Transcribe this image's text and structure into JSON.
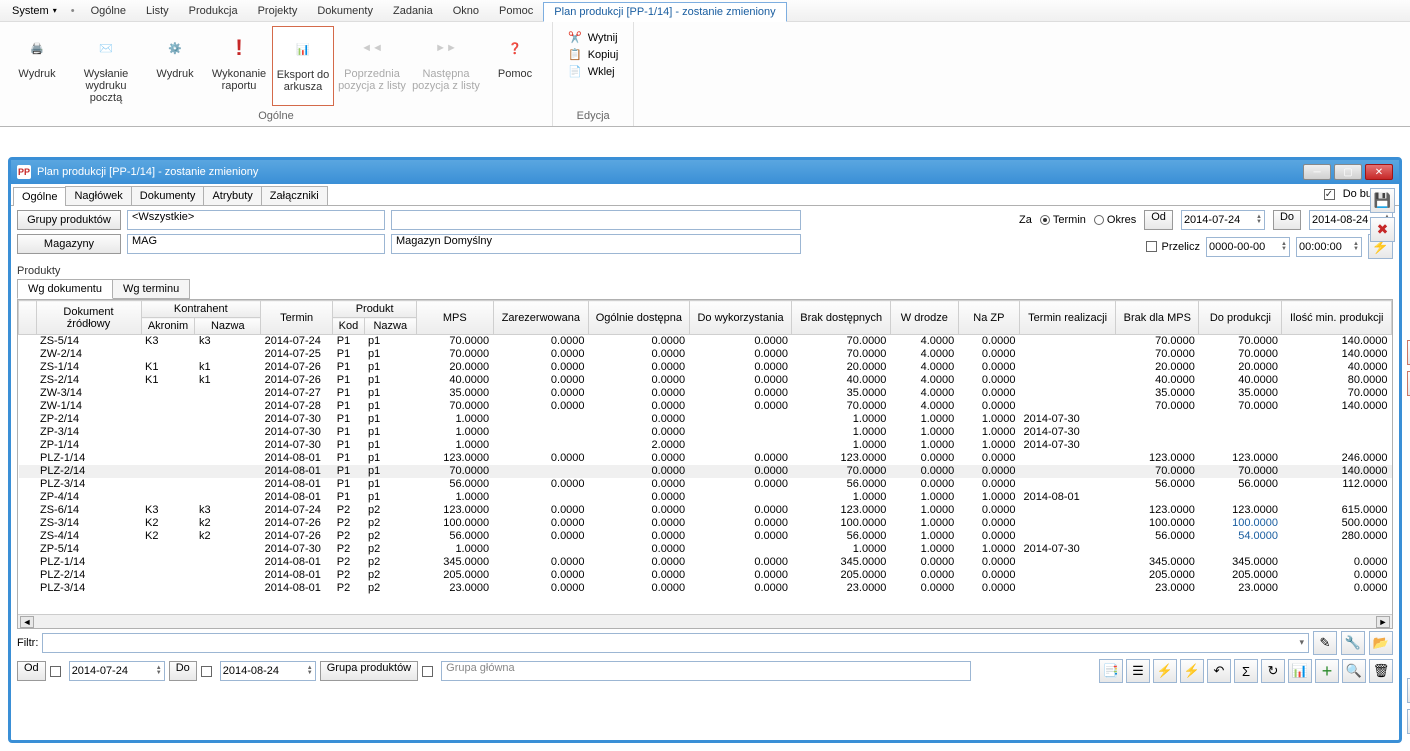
{
  "menubar": {
    "system": "System",
    "items": [
      "Ogólne",
      "Listy",
      "Produkcja",
      "Projekty",
      "Dokumenty",
      "Zadania",
      "Okno",
      "Pomoc"
    ],
    "active_tab": "Plan produkcji [PP-1/14] - zostanie zmieniony"
  },
  "ribbon": {
    "wydruk": "Wydruk",
    "wyslanie": "Wysłanie wydruku pocztą",
    "wydruk2": "Wydruk",
    "wykonanie": "Wykonanie raportu",
    "eksport": "Eksport do arkusza",
    "poprzednia": "Poprzednia pozycja z listy",
    "nastepna": "Następna pozycja z listy",
    "pomoc": "Pomoc",
    "group_ogolne": "Ogólne",
    "wytnij": "Wytnij",
    "kopiuj": "Kopiuj",
    "wklej": "Wklej",
    "group_edycja": "Edycja"
  },
  "window": {
    "title": "Plan produkcji [PP-1/14] - zostanie zmieniony",
    "tabs": [
      "Ogólne",
      "Nagłówek",
      "Dokumenty",
      "Atrybuty",
      "Załączniki"
    ],
    "do_bufora": "Do bufora",
    "grupy_btn": "Grupy produktów",
    "grupy_val": "<Wszystkie>",
    "magazyny_btn": "Magazyny",
    "magazyny_val": "MAG",
    "magazyn_name": "Magazyn Domyślny",
    "za_label": "Za",
    "termin": "Termin",
    "okres": "Okres",
    "od": "Od",
    "do": "Do",
    "date_od": "2014-07-24",
    "date_do": "2014-08-24",
    "przelicz": "Przelicz",
    "przelicz_date": "0000-00-00",
    "przelicz_time": "00:00:00",
    "produkty": "Produkty",
    "subtabs": [
      "Wg dokumentu",
      "Wg terminu"
    ],
    "headers": {
      "dok": "Dokument źródłowy",
      "kontrahent": "Kontrahent",
      "akronim": "Akronim",
      "nazwa": "Nazwa",
      "termin": "Termin",
      "produkt": "Produkt",
      "kod": "Kod",
      "nazwa2": "Nazwa",
      "mps": "MPS",
      "zarez": "Zarezerwowana",
      "ogolnie": "Ogólnie dostępna",
      "dowyk": "Do wykorzystania",
      "brak": "Brak dostępnych",
      "wdrodze": "W drodze",
      "nazp": "Na ZP",
      "terminr": "Termin realizacji",
      "brakmps": "Brak dla MPS",
      "doprod": "Do produkcji",
      "iloscmin": "Ilość min. produkcji"
    },
    "rows": [
      {
        "dok": "ZS-5/14",
        "akr": "K3",
        "naz": "k3",
        "term": "2014-07-24",
        "kod": "P1",
        "pn": "p1",
        "mps": "70.0000",
        "zar": "0.0000",
        "og": "0.0000",
        "dw": "0.0000",
        "bd": "70.0000",
        "wd": "4.0000",
        "nz": "0.0000",
        "tr": "",
        "bm": "70.0000",
        "dp": "70.0000",
        "im": "140.0000"
      },
      {
        "dok": "ZW-2/14",
        "akr": "",
        "naz": "",
        "term": "2014-07-25",
        "kod": "P1",
        "pn": "p1",
        "mps": "70.0000",
        "zar": "0.0000",
        "og": "0.0000",
        "dw": "0.0000",
        "bd": "70.0000",
        "wd": "4.0000",
        "nz": "0.0000",
        "tr": "",
        "bm": "70.0000",
        "dp": "70.0000",
        "im": "140.0000"
      },
      {
        "dok": "ZS-1/14",
        "akr": "K1",
        "naz": "k1",
        "term": "2014-07-26",
        "kod": "P1",
        "pn": "p1",
        "mps": "20.0000",
        "zar": "0.0000",
        "og": "0.0000",
        "dw": "0.0000",
        "bd": "20.0000",
        "wd": "4.0000",
        "nz": "0.0000",
        "tr": "",
        "bm": "20.0000",
        "dp": "20.0000",
        "im": "40.0000"
      },
      {
        "dok": "ZS-2/14",
        "akr": "K1",
        "naz": "k1",
        "term": "2014-07-26",
        "kod": "P1",
        "pn": "p1",
        "mps": "40.0000",
        "zar": "0.0000",
        "og": "0.0000",
        "dw": "0.0000",
        "bd": "40.0000",
        "wd": "4.0000",
        "nz": "0.0000",
        "tr": "",
        "bm": "40.0000",
        "dp": "40.0000",
        "im": "80.0000"
      },
      {
        "dok": "ZW-3/14",
        "akr": "",
        "naz": "",
        "term": "2014-07-27",
        "kod": "P1",
        "pn": "p1",
        "mps": "35.0000",
        "zar": "0.0000",
        "og": "0.0000",
        "dw": "0.0000",
        "bd": "35.0000",
        "wd": "4.0000",
        "nz": "0.0000",
        "tr": "",
        "bm": "35.0000",
        "dp": "35.0000",
        "im": "70.0000"
      },
      {
        "dok": "ZW-1/14",
        "akr": "",
        "naz": "",
        "term": "2014-07-28",
        "kod": "P1",
        "pn": "p1",
        "mps": "70.0000",
        "zar": "0.0000",
        "og": "0.0000",
        "dw": "0.0000",
        "bd": "70.0000",
        "wd": "4.0000",
        "nz": "0.0000",
        "tr": "",
        "bm": "70.0000",
        "dp": "70.0000",
        "im": "140.0000"
      },
      {
        "dok": "ZP-2/14",
        "akr": "",
        "naz": "",
        "term": "2014-07-30",
        "kod": "P1",
        "pn": "p1",
        "mps": "1.0000",
        "zar": "",
        "og": "0.0000",
        "dw": "",
        "bd": "1.0000",
        "wd": "1.0000",
        "nz": "1.0000",
        "tr": "2014-07-30",
        "bm": "",
        "dp": "",
        "im": ""
      },
      {
        "dok": "ZP-3/14",
        "akr": "",
        "naz": "",
        "term": "2014-07-30",
        "kod": "P1",
        "pn": "p1",
        "mps": "1.0000",
        "zar": "",
        "og": "0.0000",
        "dw": "",
        "bd": "1.0000",
        "wd": "1.0000",
        "nz": "1.0000",
        "tr": "2014-07-30",
        "bm": "",
        "dp": "",
        "im": ""
      },
      {
        "dok": "ZP-1/14",
        "akr": "",
        "naz": "",
        "term": "2014-07-30",
        "kod": "P1",
        "pn": "p1",
        "mps": "1.0000",
        "zar": "",
        "og": "2.0000",
        "dw": "",
        "bd": "1.0000",
        "wd": "1.0000",
        "nz": "1.0000",
        "tr": "2014-07-30",
        "bm": "",
        "dp": "",
        "im": ""
      },
      {
        "dok": "PLZ-1/14",
        "akr": "",
        "naz": "",
        "term": "2014-08-01",
        "kod": "P1",
        "pn": "p1",
        "mps": "123.0000",
        "zar": "0.0000",
        "og": "0.0000",
        "dw": "0.0000",
        "bd": "123.0000",
        "wd": "0.0000",
        "nz": "0.0000",
        "tr": "",
        "bm": "123.0000",
        "dp": "123.0000",
        "im": "246.0000"
      },
      {
        "dok": "PLZ-2/14",
        "akr": "",
        "naz": "",
        "term": "2014-08-01",
        "kod": "P1",
        "pn": "p1",
        "mps": "70.0000",
        "zar": "",
        "og": "0.0000",
        "dw": "0.0000",
        "bd": "70.0000",
        "wd": "0.0000",
        "nz": "0.0000",
        "tr": "",
        "bm": "70.0000",
        "dp": "70.0000",
        "im": "140.0000",
        "hl": true
      },
      {
        "dok": "PLZ-3/14",
        "akr": "",
        "naz": "",
        "term": "2014-08-01",
        "kod": "P1",
        "pn": "p1",
        "mps": "56.0000",
        "zar": "0.0000",
        "og": "0.0000",
        "dw": "0.0000",
        "bd": "56.0000",
        "wd": "0.0000",
        "nz": "0.0000",
        "tr": "",
        "bm": "56.0000",
        "dp": "56.0000",
        "im": "112.0000"
      },
      {
        "dok": "ZP-4/14",
        "akr": "",
        "naz": "",
        "term": "2014-08-01",
        "kod": "P1",
        "pn": "p1",
        "mps": "1.0000",
        "zar": "",
        "og": "0.0000",
        "dw": "",
        "bd": "1.0000",
        "wd": "1.0000",
        "nz": "1.0000",
        "tr": "2014-08-01",
        "bm": "",
        "dp": "",
        "im": ""
      },
      {
        "dok": "ZS-6/14",
        "akr": "K3",
        "naz": "k3",
        "term": "2014-07-24",
        "kod": "P2",
        "pn": "p2",
        "mps": "123.0000",
        "zar": "0.0000",
        "og": "0.0000",
        "dw": "0.0000",
        "bd": "123.0000",
        "wd": "1.0000",
        "nz": "0.0000",
        "tr": "",
        "bm": "123.0000",
        "dp": "123.0000",
        "im": "615.0000"
      },
      {
        "dok": "ZS-3/14",
        "akr": "K2",
        "naz": "k2",
        "term": "2014-07-26",
        "kod": "P2",
        "pn": "p2",
        "mps": "100.0000",
        "zar": "0.0000",
        "og": "0.0000",
        "dw": "0.0000",
        "bd": "100.0000",
        "wd": "1.0000",
        "nz": "0.0000",
        "tr": "",
        "bm": "100.0000",
        "dp": "100.0000",
        "im": "500.0000",
        "bluedp": true
      },
      {
        "dok": "ZS-4/14",
        "akr": "K2",
        "naz": "k2",
        "term": "2014-07-26",
        "kod": "P2",
        "pn": "p2",
        "mps": "56.0000",
        "zar": "0.0000",
        "og": "0.0000",
        "dw": "0.0000",
        "bd": "56.0000",
        "wd": "1.0000",
        "nz": "0.0000",
        "tr": "",
        "bm": "56.0000",
        "dp": "54.0000",
        "im": "280.0000",
        "bluedp": true
      },
      {
        "dok": "ZP-5/14",
        "akr": "",
        "naz": "",
        "term": "2014-07-30",
        "kod": "P2",
        "pn": "p2",
        "mps": "1.0000",
        "zar": "",
        "og": "0.0000",
        "dw": "",
        "bd": "1.0000",
        "wd": "1.0000",
        "nz": "1.0000",
        "tr": "2014-07-30",
        "bm": "",
        "dp": "",
        "im": ""
      },
      {
        "dok": "PLZ-1/14",
        "akr": "",
        "naz": "",
        "term": "2014-08-01",
        "kod": "P2",
        "pn": "p2",
        "mps": "345.0000",
        "zar": "0.0000",
        "og": "0.0000",
        "dw": "0.0000",
        "bd": "345.0000",
        "wd": "0.0000",
        "nz": "0.0000",
        "tr": "",
        "bm": "345.0000",
        "dp": "345.0000",
        "im": "0.0000"
      },
      {
        "dok": "PLZ-2/14",
        "akr": "",
        "naz": "",
        "term": "2014-08-01",
        "kod": "P2",
        "pn": "p2",
        "mps": "205.0000",
        "zar": "0.0000",
        "og": "0.0000",
        "dw": "0.0000",
        "bd": "205.0000",
        "wd": "0.0000",
        "nz": "0.0000",
        "tr": "",
        "bm": "205.0000",
        "dp": "205.0000",
        "im": "0.0000"
      },
      {
        "dok": "PLZ-3/14",
        "akr": "",
        "naz": "",
        "term": "2014-08-01",
        "kod": "P2",
        "pn": "p2",
        "mps": "23.0000",
        "zar": "0.0000",
        "og": "0.0000",
        "dw": "0.0000",
        "bd": "23.0000",
        "wd": "0.0000",
        "nz": "0.0000",
        "tr": "",
        "bm": "23.0000",
        "dp": "23.0000",
        "im": "0.0000"
      }
    ],
    "filtr": "Filtr:",
    "bottom_od": "Od",
    "bottom_do": "Do",
    "bottom_date_od": "2014-07-24",
    "bottom_date_do": "2014-08-24",
    "grupa_btn": "Grupa produktów",
    "grupa_val": "Grupa główna"
  }
}
